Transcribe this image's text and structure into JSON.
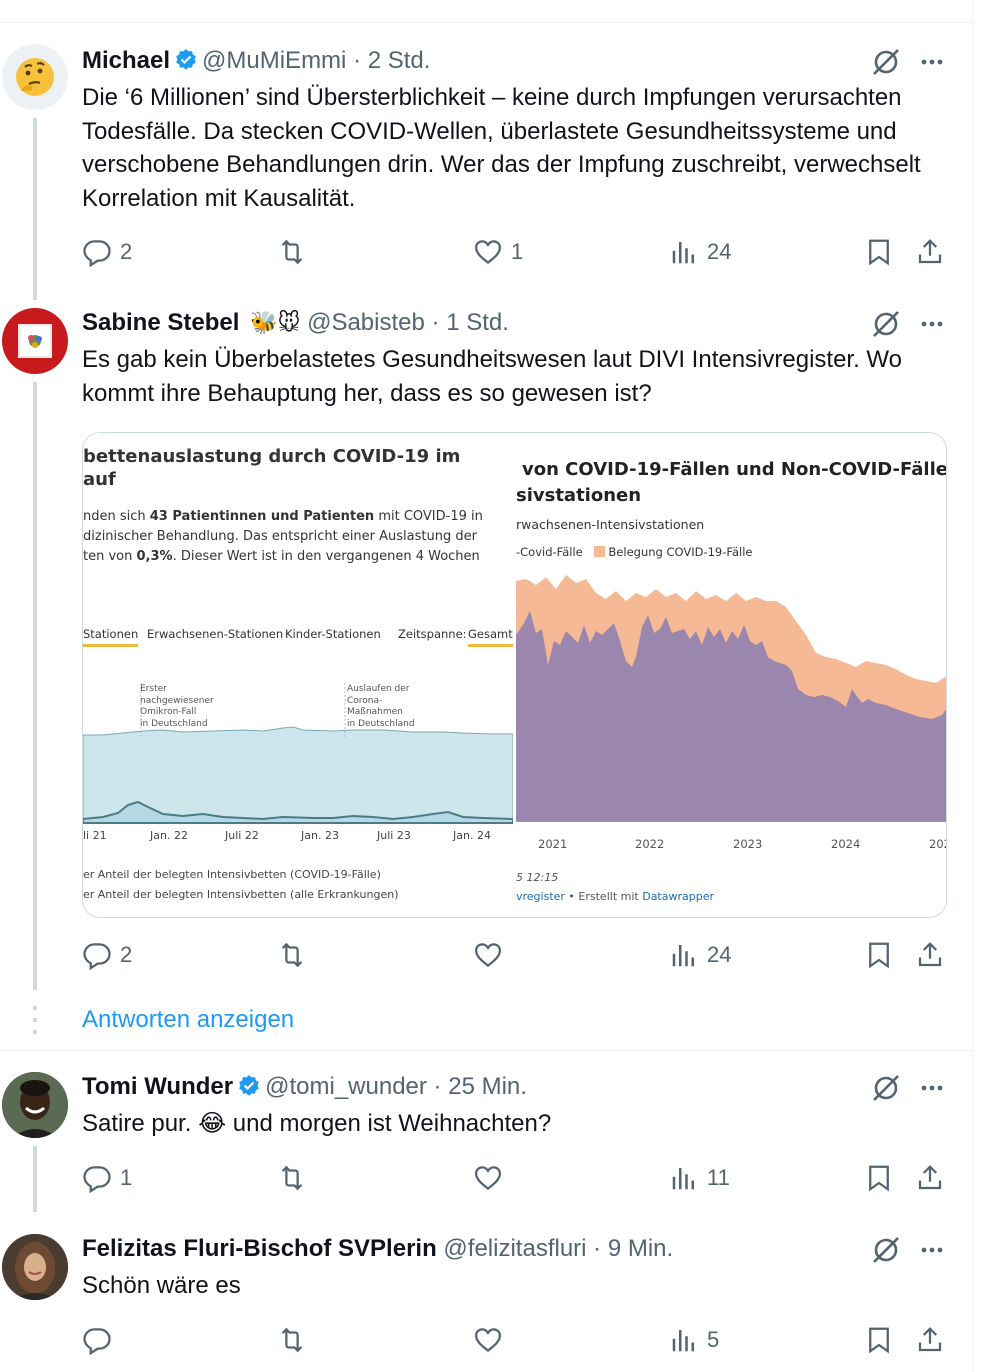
{
  "tweets": [
    {
      "name": "Michael",
      "verified": true,
      "handle": "@MuMiEmmi",
      "sep": "·",
      "time": "2 Std.",
      "avatar_icon": "thinking-face-emoji",
      "text": "Die ‘6 Millionen’ sind Übersterblichkeit – keine durch Impfungen verursachten Todesfälle. Da stecken COVID-Wellen, überlastete Gesundheitssysteme und verschobene Behandlungen drin. Wer das der Impfung zuschreibt, verwechselt Korrelation mit Kausalität.",
      "replies": "2",
      "retweets": "",
      "likes": "1",
      "views": "24"
    },
    {
      "name": "Sabine Stebel",
      "badge": "🐝🐭",
      "handle": "@Sabisteb",
      "sep": "·",
      "time": "1 Std.",
      "text": "Es gab kein Überbelastetes Gesundheitswesen laut DIVI Intensivregister. Wo kommt ihre Behauptung her, dass es so gewesen ist?",
      "replies": "2",
      "retweets": "",
      "likes": "",
      "views": "24"
    },
    {
      "name": "Tomi Wunder",
      "verified": true,
      "handle": "@tomi_wunder",
      "sep": "·",
      "time": "25 Min.",
      "text": "Satire pur. 😂 und morgen ist Weihnachten?",
      "replies": "1",
      "retweets": "",
      "likes": "",
      "views": "11"
    },
    {
      "name": "Felizitas Fluri-Bischof SVPlerin",
      "handle": "@felizitasfluri",
      "sep": "·",
      "time": "9 Min.",
      "text": "Schön wäre es",
      "replies": "",
      "retweets": "",
      "likes": "",
      "views": "5"
    }
  ],
  "show_replies": "Antworten anzeigen",
  "media_left": {
    "title_line1": "bettenauslastung durch COVID-19 im",
    "title_line2": "auf",
    "desc_line1_a": "nden sich ",
    "desc_line1_b": "43 Patientinnen und Patienten",
    "desc_line1_c": " mit COVID-19 in",
    "desc_line2": "dizinischer Behandlung. Das entspricht einer Auslastung der",
    "desc_line3_a": "ten von ",
    "desc_line3_b": "0,3%",
    "desc_line3_c": ". Dieser Wert ist in den vergangenen 4 Wochen",
    "tabs": [
      "Stationen",
      "Erwachsenen-Stationen",
      "Kinder-Stationen"
    ],
    "zeitspanne_label": "Zeitspanne:",
    "zeitspanne_value": "Gesamtv",
    "annotation1": [
      "Erster",
      "nachgewiesener",
      "Omikron-Fall",
      "in Deutschland"
    ],
    "annotation2": [
      "Auslaufen der",
      "Corona-",
      "Maßnahmen",
      "in Deutschland"
    ],
    "x_ticks": [
      "li 21",
      "Jan. 22",
      "Juli 22",
      "Jan. 23",
      "Juli 23",
      "Jan. 24"
    ],
    "legend1": "er Anteil der belegten Intensivbetten (COVID-19-Fälle)",
    "legend2": "er Anteil der belegten Intensivbetten (alle Erkrankungen)"
  },
  "media_right": {
    "title_line1": "von COVID-19-Fällen und Non-COVID-Fälle",
    "title_line2": "sivstationen",
    "subtitle": "rwachsenen-Intensivstationen",
    "legend_a": "-Covid-Fälle",
    "legend_b": "Belegung COVID-19-Fälle",
    "x_ticks": [
      "2021",
      "2022",
      "2023",
      "2024",
      "202"
    ],
    "footer_time": "5 12:15",
    "footer_source_a": "vregister",
    "footer_source_b": " • Erstellt mit ",
    "footer_source_c": "Datawrapper",
    "colors": {
      "non_covid": "#9b87ad",
      "covid": "#f5b995"
    }
  }
}
